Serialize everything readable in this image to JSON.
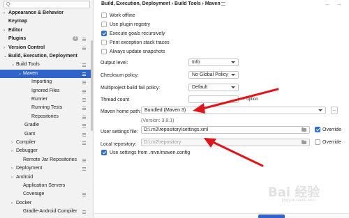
{
  "search": {
    "placeholder": "Q-"
  },
  "sidebar": {
    "items": [
      {
        "label": "Appearance & Behavior",
        "chevron": ">",
        "bold": true,
        "page_icon": false
      },
      {
        "label": "Keymap",
        "chevron": "",
        "bold": true,
        "page_icon": false
      },
      {
        "label": "Editor",
        "chevron": ">",
        "bold": true,
        "page_icon": false
      },
      {
        "label": "Plugins",
        "chevron": "",
        "bold": true,
        "page_icon": true,
        "badge": "3"
      },
      {
        "label": "Version Control",
        "chevron": ">",
        "bold": true,
        "page_icon": true
      },
      {
        "label": "Build, Execution, Deployment",
        "chevron": "v",
        "bold": true,
        "page_icon": false
      },
      {
        "label": "Build Tools",
        "chevron": "v",
        "bold": false,
        "page_icon": true
      },
      {
        "label": "Maven",
        "chevron": "v",
        "bold": false,
        "page_icon": true,
        "selected": true
      },
      {
        "label": "Importing",
        "chevron": "",
        "bold": false,
        "page_icon": true
      },
      {
        "label": "Ignored Files",
        "chevron": "",
        "bold": false,
        "page_icon": true
      },
      {
        "label": "Runner",
        "chevron": "",
        "bold": false,
        "page_icon": true
      },
      {
        "label": "Running Tests",
        "chevron": "",
        "bold": false,
        "page_icon": true
      },
      {
        "label": "Repositories",
        "chevron": "",
        "bold": false,
        "page_icon": true
      },
      {
        "label": "Gradle",
        "chevron": "",
        "bold": false,
        "page_icon": true
      },
      {
        "label": "Gant",
        "chevron": "",
        "bold": false,
        "page_icon": true
      },
      {
        "label": "Compiler",
        "chevron": ">",
        "bold": false,
        "page_icon": true
      },
      {
        "label": "Debugger",
        "chevron": ">",
        "bold": false,
        "page_icon": false
      },
      {
        "label": "Remote Jar Repositories",
        "chevron": "",
        "bold": false,
        "page_icon": true
      },
      {
        "label": "Deployment",
        "chevron": ">",
        "bold": false,
        "page_icon": true
      },
      {
        "label": "Android",
        "chevron": ">",
        "bold": false,
        "page_icon": false
      },
      {
        "label": "Application Servers",
        "chevron": "",
        "bold": false,
        "page_icon": false
      },
      {
        "label": "Coverage",
        "chevron": "",
        "bold": false,
        "page_icon": true
      },
      {
        "label": "Docker",
        "chevron": ">",
        "bold": false,
        "page_icon": false
      },
      {
        "label": "Gradle-Android Compiler",
        "chevron": "",
        "bold": false,
        "page_icon": true
      }
    ]
  },
  "header": {
    "breadcrumb": "Build, Execution, Deployment  ›  Build Tools  ›  Maven",
    "back": "←",
    "forward": "→"
  },
  "options": {
    "work_offline": {
      "label": "Work offline",
      "checked": false
    },
    "use_plugin_registry": {
      "label": "Use plugin registry",
      "checked": false
    },
    "execute_goals_recursively": {
      "label": "Execute goals recursively",
      "checked": true
    },
    "print_exception_stack_traces": {
      "label": "Print exception stack traces",
      "checked": false
    },
    "always_update_snapshots": {
      "label": "Always update snapshots",
      "checked": false
    }
  },
  "form": {
    "output_level": {
      "label": "Output level:",
      "value": "Info"
    },
    "checksum_policy": {
      "label": "Checksum policy:",
      "value": "No Global Policy"
    },
    "fail_policy": {
      "label": "Multiproject build fail policy:",
      "value": "Default"
    },
    "thread_count": {
      "label": "Thread count",
      "value": "",
      "suffix": "-T option"
    },
    "maven_home": {
      "label": "Maven home path:",
      "value": "Bundled (Maven 3)",
      "browse": "..."
    },
    "version": "(Version: 3.8.1)",
    "settings_file": {
      "label": "User settings file:",
      "value": "D:\\.m2\\repository\\settings.xml",
      "override_label": "Override",
      "override": true
    },
    "local_repo": {
      "label": "Local repository:",
      "value": "D:\\.m2\\repository",
      "override_label": "Override",
      "override": false
    },
    "use_config": {
      "label": "Use settings from .mvn/maven.config",
      "checked": true
    }
  },
  "watermark": {
    "text": "Bai 经验",
    "sub": "jingyan.baidu.com"
  },
  "colors": {
    "selection": "#2f65ca",
    "checkbox_on": "#2f6fd8",
    "arrow": "#e0141b"
  }
}
